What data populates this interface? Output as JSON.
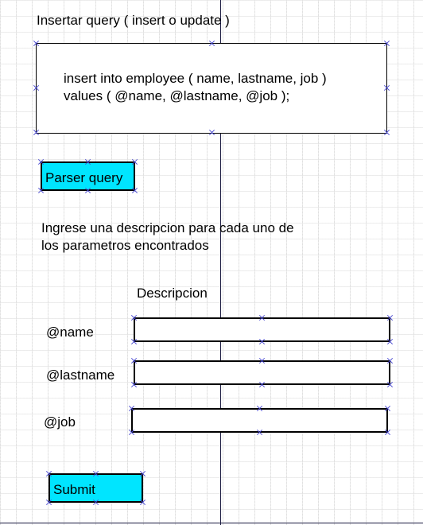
{
  "header": {
    "title": "Insertar query ( insert o update )"
  },
  "query": {
    "line1": "insert into employee ( name, lastname, job )",
    "line2": "values ( @name, @lastname, @job );"
  },
  "parser_button": {
    "label": "Parser query"
  },
  "instructions": {
    "line1": "Ingrese una descripcion para cada uno de",
    "line2": "los parametros encontrados"
  },
  "params": {
    "column_header": "Descripcion",
    "items": [
      {
        "label": "@name",
        "value": ""
      },
      {
        "label": "@lastname",
        "value": ""
      },
      {
        "label": "@job",
        "value": ""
      }
    ]
  },
  "submit_button": {
    "label": "Submit"
  },
  "colors": {
    "button_fill": "#00e5ff",
    "guide_line": "#1a1a40",
    "handle": "#4a4ad0"
  }
}
